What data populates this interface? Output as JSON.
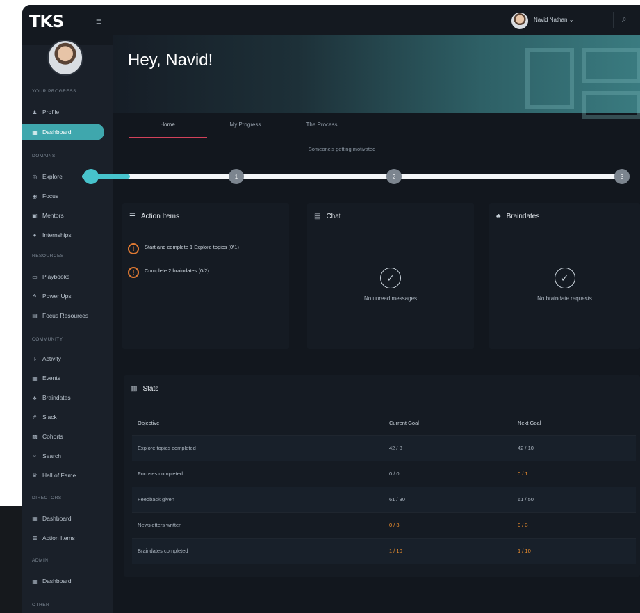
{
  "brand": {
    "logo": "TKS"
  },
  "user": {
    "name": "Navid Nathan"
  },
  "sidebar": {
    "sections": [
      {
        "title": "YOUR PROGRESS",
        "items": [
          {
            "label": "Profile",
            "icon": "person-icon"
          },
          {
            "label": "Dashboard",
            "icon": "dashboard-icon",
            "active": true
          }
        ]
      },
      {
        "title": "DOMAINS",
        "items": [
          {
            "label": "Explore",
            "icon": "globe-icon"
          },
          {
            "label": "Focus",
            "icon": "target-icon"
          },
          {
            "label": "Mentors",
            "icon": "mentor-icon"
          },
          {
            "label": "Internships",
            "icon": "briefcase-icon"
          }
        ]
      },
      {
        "title": "RESOURCES",
        "items": [
          {
            "label": "Playbooks",
            "icon": "book-icon"
          },
          {
            "label": "Power Ups",
            "icon": "bolt-icon"
          },
          {
            "label": "Focus Resources",
            "icon": "folder-icon"
          }
        ]
      },
      {
        "title": "COMMUNITY",
        "items": [
          {
            "label": "Activity",
            "icon": "activity-icon"
          },
          {
            "label": "Events",
            "icon": "calendar-icon"
          },
          {
            "label": "Braindates",
            "icon": "people-icon"
          },
          {
            "label": "Slack",
            "icon": "slack-icon"
          },
          {
            "label": "Cohorts",
            "icon": "group-icon"
          },
          {
            "label": "Search",
            "icon": "search-icon"
          },
          {
            "label": "Hall of Fame",
            "icon": "trophy-icon"
          }
        ]
      },
      {
        "title": "DIRECTORS",
        "items": [
          {
            "label": "Dashboard",
            "icon": "dashboard-icon"
          },
          {
            "label": "Action Items",
            "icon": "checklist-icon"
          }
        ]
      },
      {
        "title": "ADMIN",
        "items": [
          {
            "label": "Dashboard",
            "icon": "dashboard-icon"
          }
        ]
      },
      {
        "title": "OTHER",
        "items": []
      }
    ]
  },
  "hero": {
    "greeting": "Hey, Navid!"
  },
  "tabs": [
    {
      "label": "Home",
      "active": true
    },
    {
      "label": "My Progress"
    },
    {
      "label": "The Process"
    }
  ],
  "progress": {
    "label": "Someone's getting motivated",
    "fill_fraction": 0.09,
    "steps": [
      "",
      "1",
      "2",
      "3"
    ]
  },
  "action_items": {
    "title": "Action Items",
    "items": [
      {
        "text": "Start and complete 1 Explore topics (0/1)"
      },
      {
        "text": "Complete 2 braindates (0/2)"
      }
    ]
  },
  "chat": {
    "title": "Chat",
    "empty_text": "No unread messages"
  },
  "braindates": {
    "title": "Braindates",
    "empty_text": "No braindate requests"
  },
  "stats": {
    "title": "Stats",
    "columns": [
      "Objective",
      "Current Goal",
      "Next Goal"
    ],
    "rows": [
      {
        "objective": "Explore topics completed",
        "current": "42 / 8",
        "next": "42 / 10",
        "current_warn": false,
        "next_warn": false
      },
      {
        "objective": "Focuses completed",
        "current": "0 / 0",
        "next": "0 / 1",
        "current_warn": false,
        "next_warn": true
      },
      {
        "objective": "Feedback given",
        "current": "61 / 30",
        "next": "61 / 50",
        "current_warn": false,
        "next_warn": false
      },
      {
        "objective": "Newsletters written",
        "current": "0 / 3",
        "next": "0 / 3",
        "current_warn": true,
        "next_warn": true
      },
      {
        "objective": "Braindates completed",
        "current": "1 / 10",
        "next": "1 / 10",
        "current_warn": true,
        "next_warn": true
      }
    ]
  },
  "colors": {
    "accent": "#3fa7ad",
    "warning": "#f0902e",
    "tab_underline": "#d2425a"
  }
}
